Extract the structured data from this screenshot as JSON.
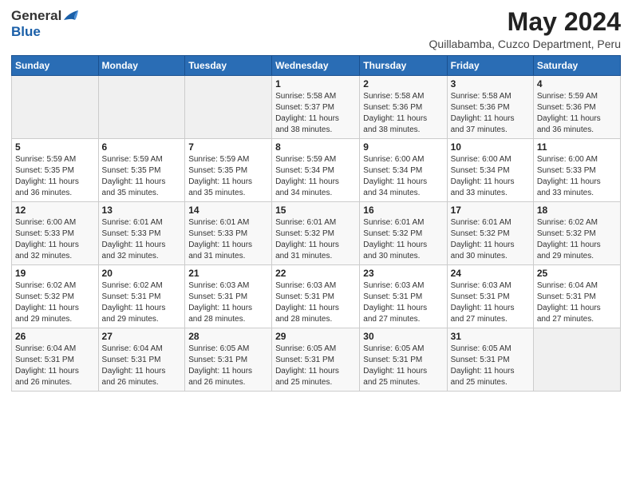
{
  "header": {
    "logo_general": "General",
    "logo_blue": "Blue",
    "title": "May 2024",
    "subtitle": "Quillabamba, Cuzco Department, Peru"
  },
  "calendar": {
    "days_of_week": [
      "Sunday",
      "Monday",
      "Tuesday",
      "Wednesday",
      "Thursday",
      "Friday",
      "Saturday"
    ],
    "weeks": [
      [
        {
          "day": "",
          "info": ""
        },
        {
          "day": "",
          "info": ""
        },
        {
          "day": "",
          "info": ""
        },
        {
          "day": "1",
          "info": "Sunrise: 5:58 AM\nSunset: 5:37 PM\nDaylight: 11 hours\nand 38 minutes."
        },
        {
          "day": "2",
          "info": "Sunrise: 5:58 AM\nSunset: 5:36 PM\nDaylight: 11 hours\nand 38 minutes."
        },
        {
          "day": "3",
          "info": "Sunrise: 5:58 AM\nSunset: 5:36 PM\nDaylight: 11 hours\nand 37 minutes."
        },
        {
          "day": "4",
          "info": "Sunrise: 5:59 AM\nSunset: 5:36 PM\nDaylight: 11 hours\nand 36 minutes."
        }
      ],
      [
        {
          "day": "5",
          "info": "Sunrise: 5:59 AM\nSunset: 5:35 PM\nDaylight: 11 hours\nand 36 minutes."
        },
        {
          "day": "6",
          "info": "Sunrise: 5:59 AM\nSunset: 5:35 PM\nDaylight: 11 hours\nand 35 minutes."
        },
        {
          "day": "7",
          "info": "Sunrise: 5:59 AM\nSunset: 5:35 PM\nDaylight: 11 hours\nand 35 minutes."
        },
        {
          "day": "8",
          "info": "Sunrise: 5:59 AM\nSunset: 5:34 PM\nDaylight: 11 hours\nand 34 minutes."
        },
        {
          "day": "9",
          "info": "Sunrise: 6:00 AM\nSunset: 5:34 PM\nDaylight: 11 hours\nand 34 minutes."
        },
        {
          "day": "10",
          "info": "Sunrise: 6:00 AM\nSunset: 5:34 PM\nDaylight: 11 hours\nand 33 minutes."
        },
        {
          "day": "11",
          "info": "Sunrise: 6:00 AM\nSunset: 5:33 PM\nDaylight: 11 hours\nand 33 minutes."
        }
      ],
      [
        {
          "day": "12",
          "info": "Sunrise: 6:00 AM\nSunset: 5:33 PM\nDaylight: 11 hours\nand 32 minutes."
        },
        {
          "day": "13",
          "info": "Sunrise: 6:01 AM\nSunset: 5:33 PM\nDaylight: 11 hours\nand 32 minutes."
        },
        {
          "day": "14",
          "info": "Sunrise: 6:01 AM\nSunset: 5:33 PM\nDaylight: 11 hours\nand 31 minutes."
        },
        {
          "day": "15",
          "info": "Sunrise: 6:01 AM\nSunset: 5:32 PM\nDaylight: 11 hours\nand 31 minutes."
        },
        {
          "day": "16",
          "info": "Sunrise: 6:01 AM\nSunset: 5:32 PM\nDaylight: 11 hours\nand 30 minutes."
        },
        {
          "day": "17",
          "info": "Sunrise: 6:01 AM\nSunset: 5:32 PM\nDaylight: 11 hours\nand 30 minutes."
        },
        {
          "day": "18",
          "info": "Sunrise: 6:02 AM\nSunset: 5:32 PM\nDaylight: 11 hours\nand 29 minutes."
        }
      ],
      [
        {
          "day": "19",
          "info": "Sunrise: 6:02 AM\nSunset: 5:32 PM\nDaylight: 11 hours\nand 29 minutes."
        },
        {
          "day": "20",
          "info": "Sunrise: 6:02 AM\nSunset: 5:31 PM\nDaylight: 11 hours\nand 29 minutes."
        },
        {
          "day": "21",
          "info": "Sunrise: 6:03 AM\nSunset: 5:31 PM\nDaylight: 11 hours\nand 28 minutes."
        },
        {
          "day": "22",
          "info": "Sunrise: 6:03 AM\nSunset: 5:31 PM\nDaylight: 11 hours\nand 28 minutes."
        },
        {
          "day": "23",
          "info": "Sunrise: 6:03 AM\nSunset: 5:31 PM\nDaylight: 11 hours\nand 27 minutes."
        },
        {
          "day": "24",
          "info": "Sunrise: 6:03 AM\nSunset: 5:31 PM\nDaylight: 11 hours\nand 27 minutes."
        },
        {
          "day": "25",
          "info": "Sunrise: 6:04 AM\nSunset: 5:31 PM\nDaylight: 11 hours\nand 27 minutes."
        }
      ],
      [
        {
          "day": "26",
          "info": "Sunrise: 6:04 AM\nSunset: 5:31 PM\nDaylight: 11 hours\nand 26 minutes."
        },
        {
          "day": "27",
          "info": "Sunrise: 6:04 AM\nSunset: 5:31 PM\nDaylight: 11 hours\nand 26 minutes."
        },
        {
          "day": "28",
          "info": "Sunrise: 6:05 AM\nSunset: 5:31 PM\nDaylight: 11 hours\nand 26 minutes."
        },
        {
          "day": "29",
          "info": "Sunrise: 6:05 AM\nSunset: 5:31 PM\nDaylight: 11 hours\nand 25 minutes."
        },
        {
          "day": "30",
          "info": "Sunrise: 6:05 AM\nSunset: 5:31 PM\nDaylight: 11 hours\nand 25 minutes."
        },
        {
          "day": "31",
          "info": "Sunrise: 6:05 AM\nSunset: 5:31 PM\nDaylight: 11 hours\nand 25 minutes."
        },
        {
          "day": "",
          "info": ""
        }
      ]
    ]
  }
}
